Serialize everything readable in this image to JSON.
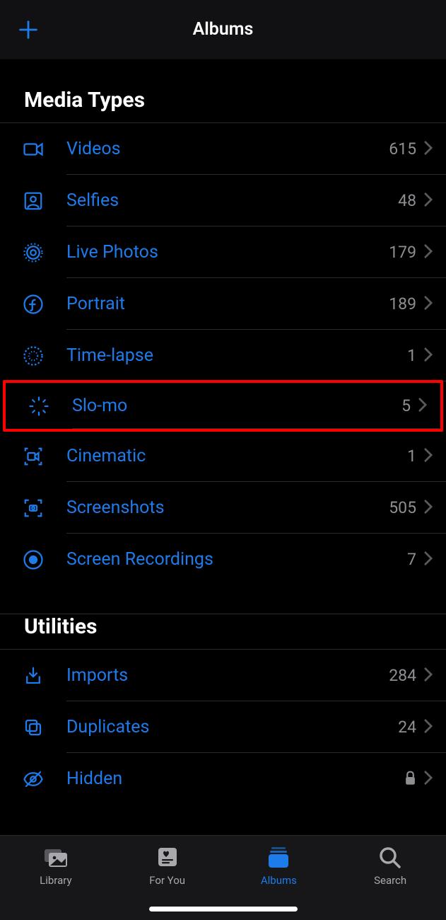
{
  "nav": {
    "title": "Albums"
  },
  "sections": {
    "media": {
      "header": "Media Types",
      "items": [
        {
          "label": "Videos",
          "count": "615",
          "icon": "video"
        },
        {
          "label": "Selfies",
          "count": "48",
          "icon": "person-square"
        },
        {
          "label": "Live Photos",
          "count": "179",
          "icon": "concentric"
        },
        {
          "label": "Portrait",
          "count": "189",
          "icon": "f-circle"
        },
        {
          "label": "Time-lapse",
          "count": "1",
          "icon": "timelapse"
        },
        {
          "label": "Slo-mo",
          "count": "5",
          "icon": "slomo",
          "highlight": true
        },
        {
          "label": "Cinematic",
          "count": "1",
          "icon": "cine"
        },
        {
          "label": "Screenshots",
          "count": "505",
          "icon": "screenshot"
        },
        {
          "label": "Screen Recordings",
          "count": "7",
          "icon": "record"
        }
      ]
    },
    "utilities": {
      "header": "Utilities",
      "items": [
        {
          "label": "Imports",
          "count": "284",
          "icon": "import"
        },
        {
          "label": "Duplicates",
          "count": "24",
          "icon": "duplicate"
        },
        {
          "label": "Hidden",
          "locked": true,
          "icon": "eye-slash"
        }
      ]
    }
  },
  "tabs": [
    {
      "label": "Library",
      "icon": "library",
      "active": false
    },
    {
      "label": "For You",
      "icon": "foryou",
      "active": false
    },
    {
      "label": "Albums",
      "icon": "albums",
      "active": true
    },
    {
      "label": "Search",
      "icon": "search",
      "active": false
    }
  ]
}
